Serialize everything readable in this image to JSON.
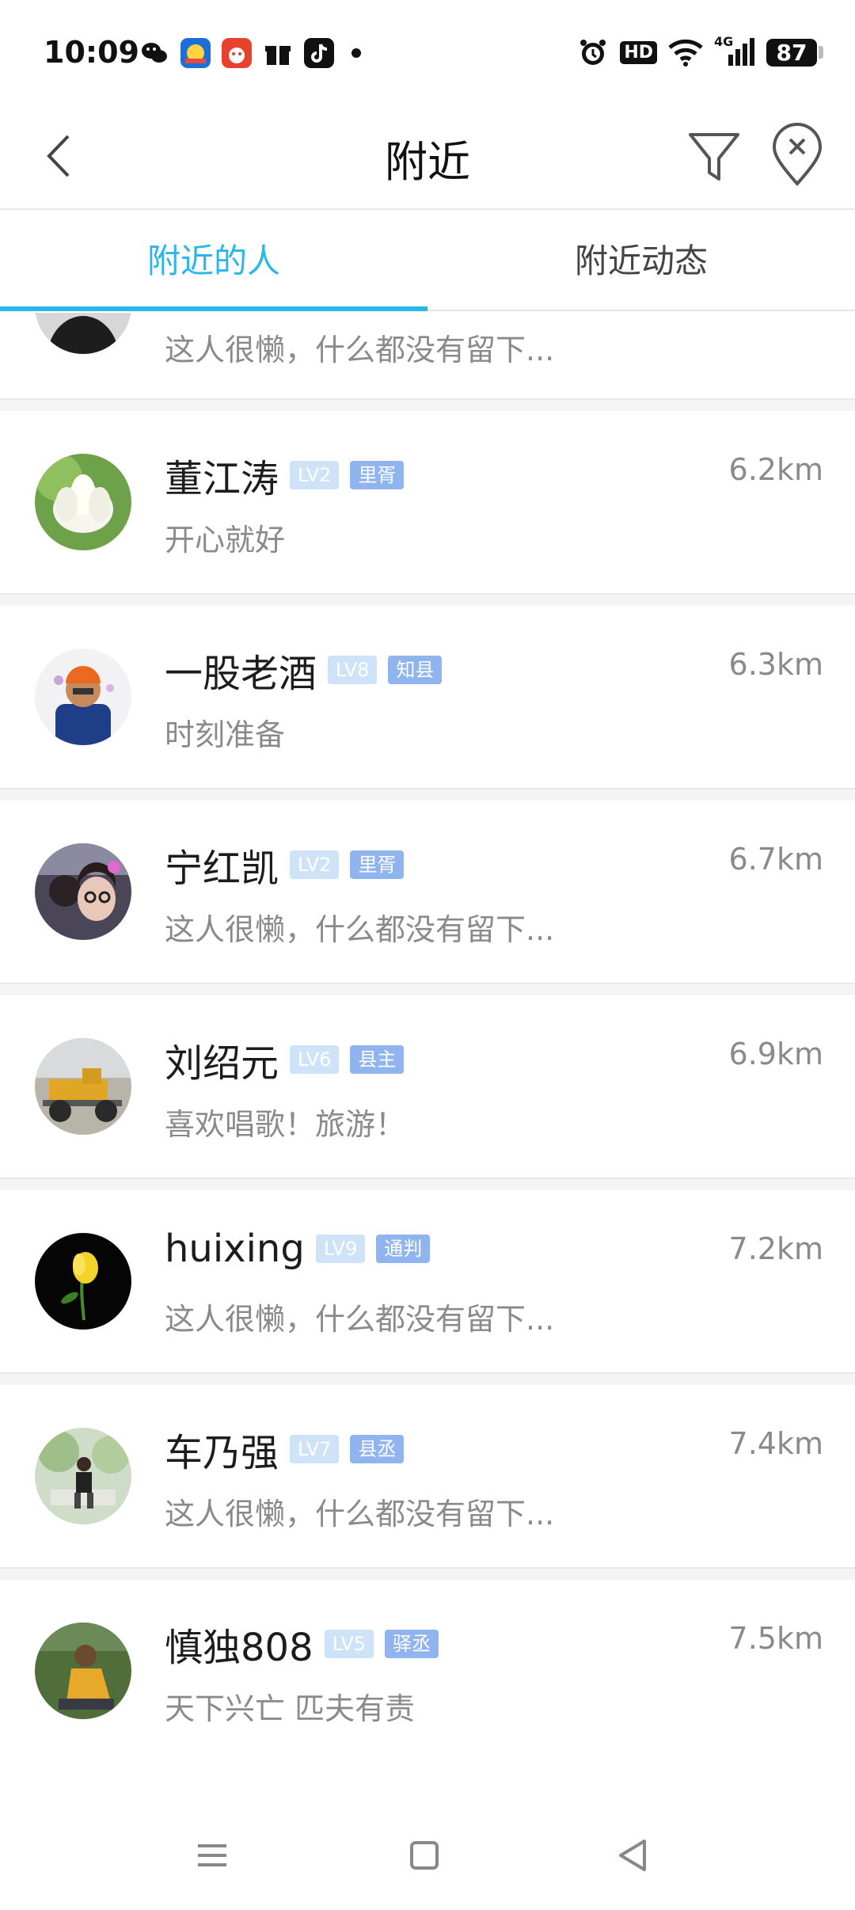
{
  "status": {
    "time": "10:09",
    "hd": "HD",
    "network": "4G",
    "battery": "87"
  },
  "nav": {
    "title": "附近"
  },
  "tabs": [
    {
      "label": "附近的人"
    },
    {
      "label": "附近动态"
    }
  ],
  "partial": {
    "signature": "这人很懒，什么都没有留下..."
  },
  "people": [
    {
      "name": "董江涛",
      "level": "LV2",
      "title": "里胥",
      "distance": "6.2km",
      "signature": "开心就好"
    },
    {
      "name": "一股老酒",
      "level": "LV8",
      "title": "知县",
      "distance": "6.3km",
      "signature": "时刻准备"
    },
    {
      "name": "宁红凯",
      "level": "LV2",
      "title": "里胥",
      "distance": "6.7km",
      "signature": "这人很懒，什么都没有留下..."
    },
    {
      "name": "刘绍元",
      "level": "LV6",
      "title": "县主",
      "distance": "6.9km",
      "signature": "喜欢唱歌！旅游！"
    },
    {
      "name": "huixing",
      "level": "LV9",
      "title": "通判",
      "distance": "7.2km",
      "signature": "这人很懒，什么都没有留下..."
    },
    {
      "name": "车乃强",
      "level": "LV7",
      "title": "县丞",
      "distance": "7.4km",
      "signature": "这人很懒，什么都没有留下..."
    },
    {
      "name": "慎独808",
      "level": "LV5",
      "title": "驿丞",
      "distance": "7.5km",
      "signature": "天下兴亡 匹夫有责"
    }
  ],
  "colors": {
    "accent": "#29b6e8",
    "level_badge": "#cfe3f8",
    "title_badge": "#8fb4ee"
  }
}
